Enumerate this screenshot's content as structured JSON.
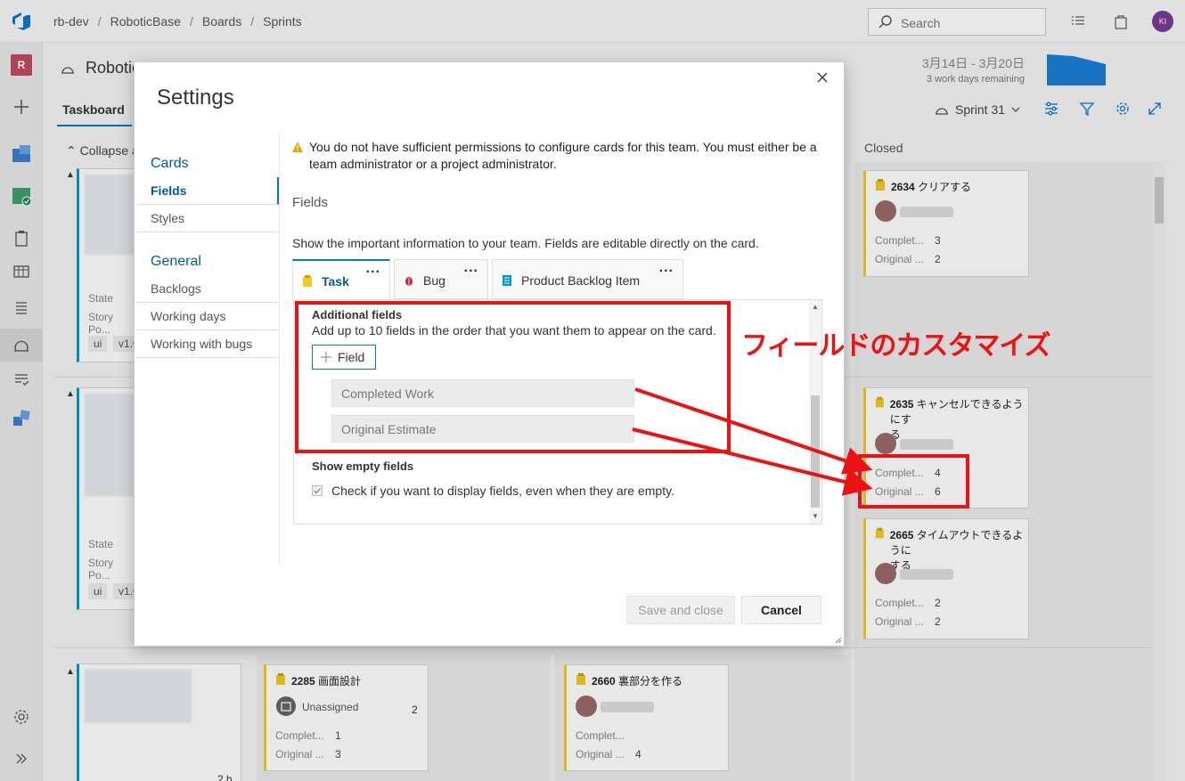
{
  "topbar": {
    "breadcrumbs": [
      "rb-dev",
      "RoboticBase",
      "Boards",
      "Sprints"
    ],
    "separator": "/",
    "search_placeholder": "Search",
    "avatar_initials": "KI"
  },
  "rail": {
    "project_initial": "R"
  },
  "page": {
    "title": "Robotic",
    "pivot": "Taskboard",
    "dates": "3月14日 - 3月20日",
    "remaining": "3 work days remaining",
    "sprint": "Sprint 31",
    "collapse": "Collapse a",
    "closed_header": "Closed"
  },
  "backlog_items": [
    {
      "state_label": "State",
      "story_label": "Story Po...",
      "tags": [
        "ui",
        "v1.0"
      ]
    },
    {
      "state_label": "State",
      "story_label": "Story Po...",
      "tags": [
        "ui",
        "v1.0"
      ]
    },
    {
      "bottom_value": "2 h"
    }
  ],
  "task_cards": [
    {
      "id": "2634",
      "title": "クリアする",
      "f1": "Complet...",
      "v1": "3",
      "f2": "Original ...",
      "v2": "2"
    },
    {
      "id": "2635",
      "title": "キャンセルできるようにす",
      "title2": "る",
      "f1": "Complet...",
      "v1": "4",
      "f2": "Original ...",
      "v2": "6"
    },
    {
      "id": "2665",
      "title": "タイムアウトできるように",
      "title2": "する",
      "f1": "Complet...",
      "v1": "2",
      "f2": "Original ...",
      "v2": "2"
    },
    {
      "id": "2285",
      "title": "画面設計",
      "assignee": "Unassigned",
      "count": "2",
      "f1": "Complet...",
      "v1": "1",
      "f2": "Original ...",
      "v2": "3"
    },
    {
      "id": "2660",
      "title": "裏部分を作る",
      "f1": "Complet...",
      "v1": "",
      "f2": "Original ...",
      "v2": "4"
    }
  ],
  "dialog": {
    "title": "Settings",
    "nav": {
      "cards_group": "Cards",
      "cards_items": [
        "Fields",
        "Styles"
      ],
      "general_group": "General",
      "general_items": [
        "Backlogs",
        "Working days",
        "Working with bugs"
      ]
    },
    "warning": "You do not have sufficient permissions to configure cards for this team. You must either be a team administrator or a project administrator.",
    "section_title": "Fields",
    "description": "Show the important information to your team. Fields are editable directly on the card.",
    "tabs": [
      {
        "label": "Task",
        "menu": "..."
      },
      {
        "label": "Bug",
        "menu": "..."
      },
      {
        "label": "Product Backlog Item",
        "menu": "..."
      }
    ],
    "additional_title": "Additional fields",
    "additional_desc": "Add up to 10 fields in the order that you want them to appear on the card.",
    "add_field_label": "Field",
    "fields": [
      "Completed Work",
      "Original Estimate"
    ],
    "show_empty_title": "Show empty fields",
    "show_empty_desc": "Check if you want to display fields, even when they are empty.",
    "show_empty_checked": true,
    "save_label": "Save and close",
    "cancel_label": "Cancel"
  },
  "annotation": {
    "text": "フィールドのカスタマイズ",
    "color": "#ee1111"
  },
  "colors": {
    "accent": "#0078d4",
    "task_bar": "#f2cb1d",
    "pbi_bar": "#009ccc"
  }
}
